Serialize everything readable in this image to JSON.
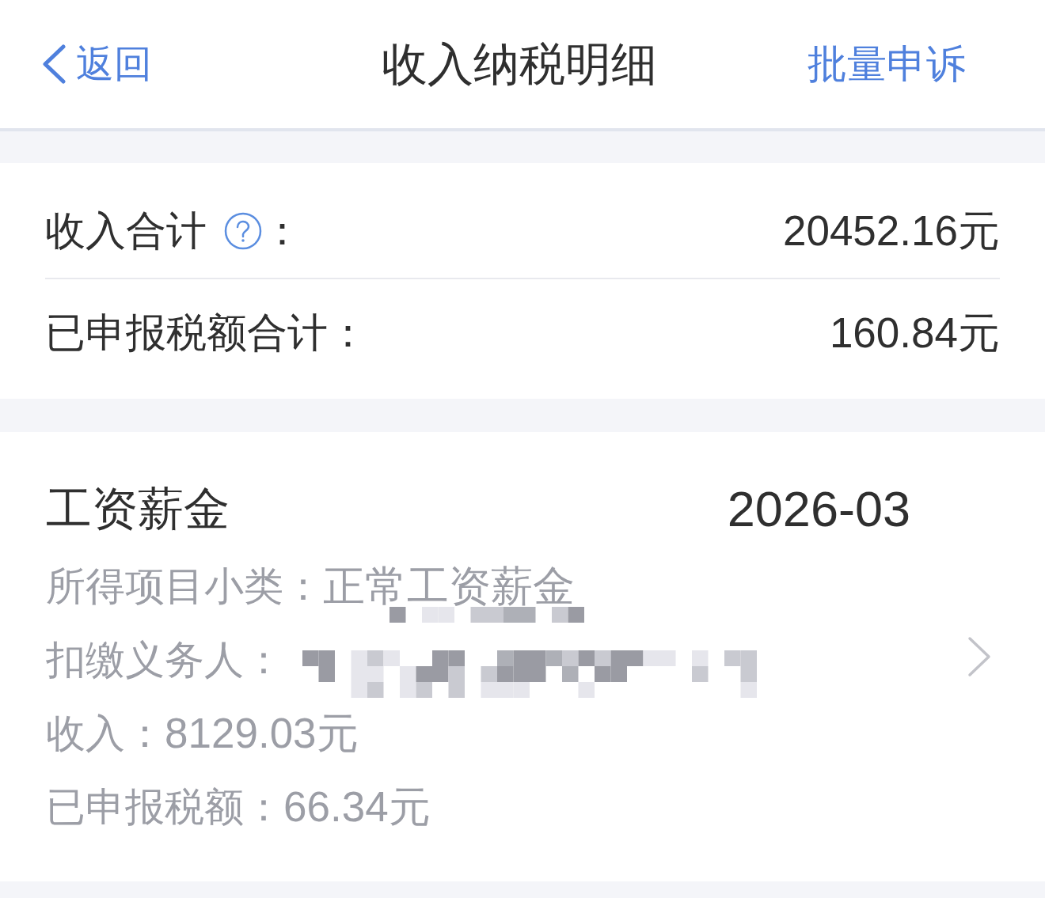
{
  "nav_bar": {
    "back": {
      "label": "返回"
    },
    "title": "收入纳税明细",
    "action": {
      "label": "批量申诉"
    }
  },
  "summary": {
    "rows": [
      {
        "label": "收入合计",
        "help": true,
        "suffix": "：",
        "value": "20452.16元"
      },
      {
        "label": "已申报税额合计：",
        "help": false,
        "value": "160.84元"
      }
    ]
  },
  "records": [
    {
      "title": "工资薪金",
      "period": "2026-03",
      "fields": [
        {
          "label": "所得项目小类：",
          "value": "正常工资薪金",
          "pixelated": true
        },
        {
          "label": "扣缴义务人：",
          "pixelated": true
        },
        {
          "label": "收入：",
          "value": "8129.03元",
          "pixelated": false
        },
        {
          "label": "已申报税额：",
          "value": "66.34元",
          "pixelated": false
        }
      ]
    }
  ]
}
